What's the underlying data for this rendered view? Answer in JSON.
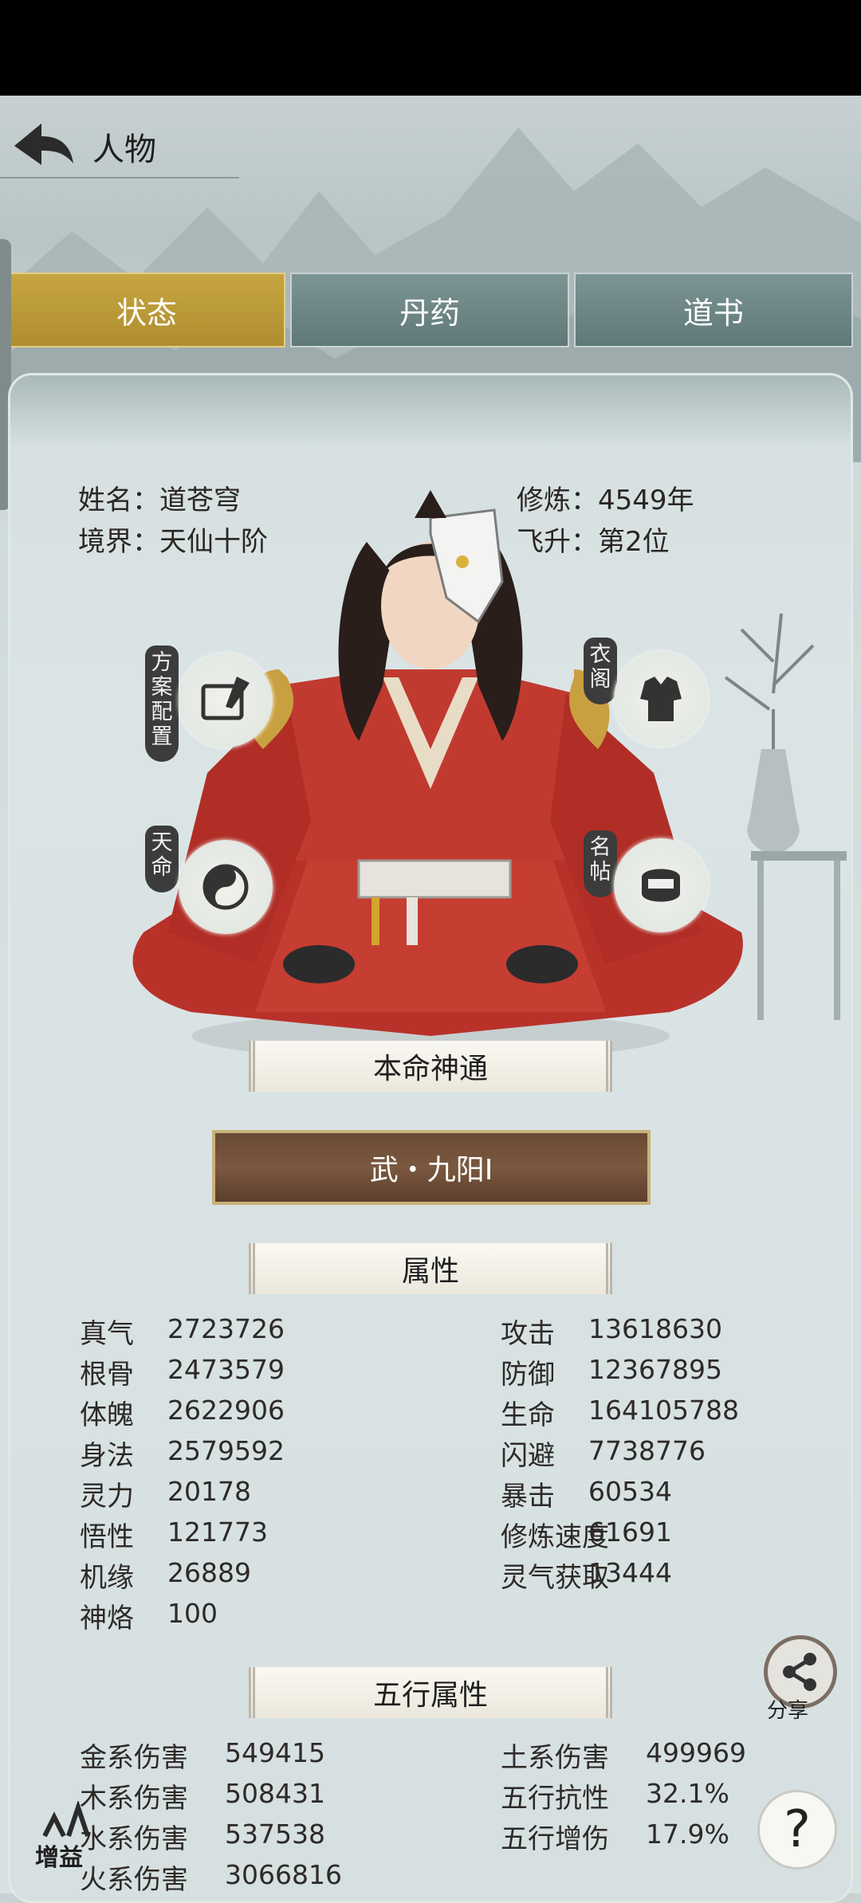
{
  "header": {
    "title": "人物"
  },
  "tabs": [
    {
      "label": "状态",
      "active": true
    },
    {
      "label": "丹药",
      "active": false
    },
    {
      "label": "道书",
      "active": false
    }
  ],
  "profile": {
    "name_label": "姓名：道苍穹",
    "realm_label": "境界：天仙十阶",
    "cultivate_label": "修炼：4549年",
    "ascend_label": "飞升：第2位"
  },
  "side_buttons": {
    "plan": "方案配置",
    "fate": "天命",
    "wardrobe": "衣阁",
    "namecard": "名帖"
  },
  "sections": {
    "innate": "本命神通",
    "skill": "武・九阳I",
    "attributes": "属性",
    "elements": "五行属性"
  },
  "attributes_left": [
    {
      "k": "真气",
      "v": "2723726"
    },
    {
      "k": "根骨",
      "v": "2473579"
    },
    {
      "k": "体魄",
      "v": "2622906"
    },
    {
      "k": "身法",
      "v": "2579592"
    },
    {
      "k": "灵力",
      "v": "20178"
    },
    {
      "k": "悟性",
      "v": "121773"
    },
    {
      "k": "机缘",
      "v": "26889"
    },
    {
      "k": "神烙",
      "v": "100"
    }
  ],
  "attributes_right": [
    {
      "k": "攻击",
      "v": "13618630"
    },
    {
      "k": "防御",
      "v": "12367895"
    },
    {
      "k": "生命",
      "v": "164105788"
    },
    {
      "k": "闪避",
      "v": "7738776"
    },
    {
      "k": "暴击",
      "v": "60534"
    },
    {
      "k": "修炼速度",
      "v": "61691"
    },
    {
      "k": "灵气获取",
      "v": "13444"
    }
  ],
  "elements_left": [
    {
      "k": "金系伤害",
      "v": "549415"
    },
    {
      "k": "木系伤害",
      "v": "508431"
    },
    {
      "k": "水系伤害",
      "v": "537538"
    },
    {
      "k": "火系伤害",
      "v": "3066816"
    }
  ],
  "elements_right": [
    {
      "k": "土系伤害",
      "v": "499969"
    },
    {
      "k": "五行抗性",
      "v": "32.1%"
    },
    {
      "k": "五行增伤",
      "v": "17.9%"
    }
  ],
  "floating": {
    "share": "分享",
    "boost": "增益",
    "help": "?"
  }
}
